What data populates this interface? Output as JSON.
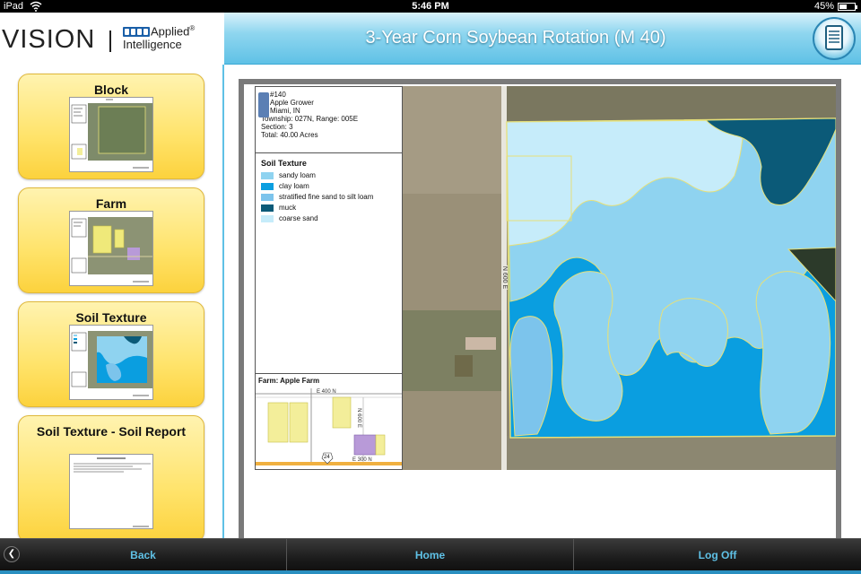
{
  "status_bar": {
    "carrier": "iPad",
    "time": "5:46 PM",
    "battery": "45%",
    "icons": [
      "wifi-icon",
      "battery-icon"
    ]
  },
  "logo": {
    "wordmark": "VISION",
    "brand_line1": "Applied",
    "brand_line2": "Intelligence"
  },
  "header": {
    "title": "3-Year Corn Soybean Rotation (M 40)",
    "icon": "tablet-icon"
  },
  "sidebar": {
    "items": [
      {
        "label": "Block"
      },
      {
        "label": "Farm"
      },
      {
        "label": "Soil Texture"
      },
      {
        "label": "Soil Texture - Soil Report"
      }
    ]
  },
  "report": {
    "info": {
      "field": "#140",
      "grower": "Apple Grower",
      "location": "Miami, IN",
      "township": "Township: 027N, Range: 005E",
      "section": "Section: 3",
      "total": "Total: 40.00 Acres"
    },
    "legend": {
      "title": "Soil Texture",
      "items": [
        {
          "label": "sandy loam",
          "color": "#8fd3f0"
        },
        {
          "label": "clay loam",
          "color": "#0a9ee0"
        },
        {
          "label": "stratified fine sand to silt loam",
          "color": "#7cc4ec"
        },
        {
          "label": "muck",
          "color": "#0b5a78"
        },
        {
          "label": "coarse sand",
          "color": "#c6ecfa"
        }
      ]
    },
    "inset": {
      "title": "Farm: Apple Farm",
      "road1": "E 400 N",
      "road2": "E 300 N",
      "road3": "N 600 E",
      "route": "24"
    },
    "map": {
      "road_label": "N 600 E"
    }
  },
  "toolbar": {
    "back": "Back",
    "home": "Home",
    "logoff": "Log Off"
  },
  "colors": {
    "header_blue": "#5fc1e6",
    "card_yellow": "#ffe36a",
    "toolbar_text": "#5fc1e6"
  }
}
